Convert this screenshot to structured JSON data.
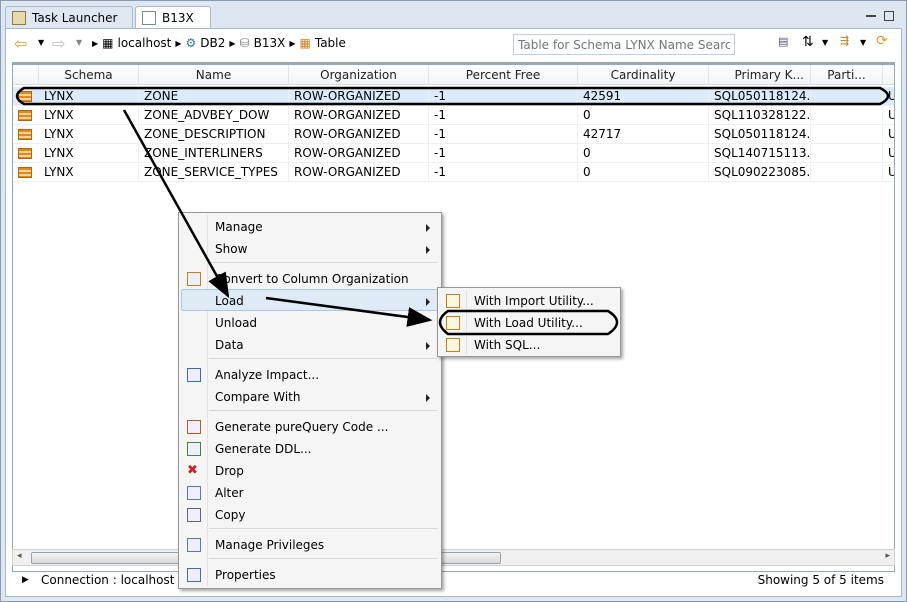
{
  "tabs": [
    {
      "label": "Task Launcher",
      "icon": "task-launcher-icon"
    },
    {
      "label": "B13X",
      "icon": "editor-icon",
      "active": true
    }
  ],
  "breadcrumb": [
    "localhost",
    "DB2",
    "B13X",
    "Table"
  ],
  "search": {
    "placeholder": "Table for Schema LYNX Name Search"
  },
  "table": {
    "columns": [
      "Schema",
      "Name",
      "Organization",
      "Percent Free",
      "Cardinality",
      "Primary K...",
      "Parti..."
    ],
    "rows": [
      [
        "LYNX",
        "ZONE",
        "ROW-ORGANIZED",
        "-1",
        "42591",
        "SQL050118124...",
        "",
        "U"
      ],
      [
        "LYNX",
        "ZONE_ADVBEY_DOW",
        "ROW-ORGANIZED",
        "-1",
        "0",
        "SQL110328122...",
        "",
        "U"
      ],
      [
        "LYNX",
        "ZONE_DESCRIPTION",
        "ROW-ORGANIZED",
        "-1",
        "42717",
        "SQL050118124...",
        "",
        "U"
      ],
      [
        "LYNX",
        "ZONE_INTERLINERS",
        "ROW-ORGANIZED",
        "-1",
        "0",
        "SQL140715113...",
        "",
        "U"
      ],
      [
        "LYNX",
        "ZONE_SERVICE_TYPES",
        "ROW-ORGANIZED",
        "-1",
        "0",
        "SQL090223085...",
        "",
        "U"
      ]
    ]
  },
  "status": {
    "left": "Connection : localhost - D",
    "right": "Showing 5 of 5 items"
  },
  "context_menu": {
    "items": [
      "Manage",
      "Show",
      "Convert to Column Organization",
      "Load",
      "Unload",
      "Data",
      "Analyze Impact...",
      "Compare With",
      "Generate pureQuery Code ...",
      "Generate DDL...",
      "Drop",
      "Alter",
      "Copy",
      "Manage Privileges",
      "Properties"
    ]
  },
  "submenu": {
    "items": [
      "With Import Utility...",
      "With Load Utility...",
      "With SQL..."
    ]
  },
  "colors": {
    "selection": "#dcebfb",
    "annotation": "#000000",
    "table_icon": "#e08a1e"
  }
}
